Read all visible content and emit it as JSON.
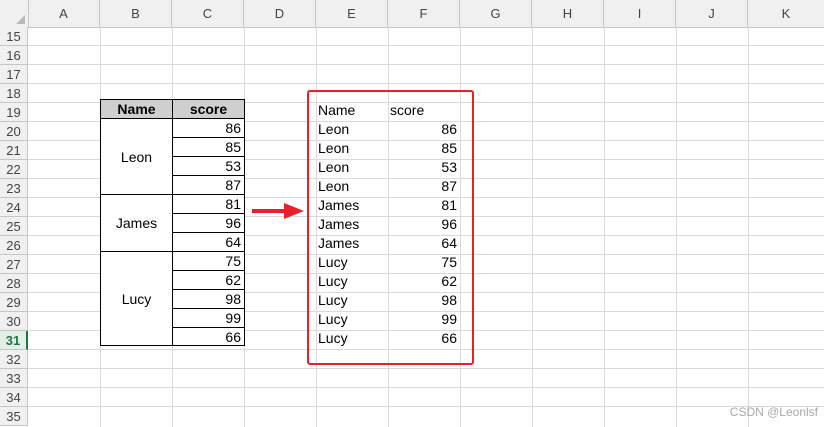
{
  "columns": [
    "A",
    "B",
    "C",
    "D",
    "E",
    "F",
    "G",
    "H",
    "I",
    "J",
    "K"
  ],
  "rows": [
    "15",
    "16",
    "17",
    "18",
    "19",
    "20",
    "21",
    "22",
    "23",
    "24",
    "25",
    "26",
    "27",
    "28",
    "29",
    "30",
    "31",
    "32",
    "33",
    "34",
    "35"
  ],
  "selected_row": "31",
  "left_table": {
    "header_name": "Name",
    "header_score": "score",
    "groups": [
      {
        "name": "Leon",
        "scores": [
          "86",
          "85",
          "53",
          "87"
        ]
      },
      {
        "name": "James",
        "scores": [
          "81",
          "96",
          "64"
        ]
      },
      {
        "name": "Lucy",
        "scores": [
          "75",
          "62",
          "98",
          "99",
          "66"
        ]
      }
    ]
  },
  "right_table": {
    "header_name": "Name",
    "header_score": "score",
    "rows": [
      {
        "name": "Leon",
        "score": "86"
      },
      {
        "name": "Leon",
        "score": "85"
      },
      {
        "name": "Leon",
        "score": "53"
      },
      {
        "name": "Leon",
        "score": "87"
      },
      {
        "name": "James",
        "score": "81"
      },
      {
        "name": "James",
        "score": "96"
      },
      {
        "name": "James",
        "score": "64"
      },
      {
        "name": "Lucy",
        "score": "75"
      },
      {
        "name": "Lucy",
        "score": "62"
      },
      {
        "name": "Lucy",
        "score": "98"
      },
      {
        "name": "Lucy",
        "score": "99"
      },
      {
        "name": "Lucy",
        "score": "66"
      }
    ]
  },
  "colors": {
    "highlight_box": "#e8202a",
    "arrow": "#e8202a",
    "header_fill": "#d0cece",
    "selected_row_accent": "#217346"
  },
  "arrow_icon": "right-arrow-icon",
  "watermark": "CSDN @Leonlsf"
}
